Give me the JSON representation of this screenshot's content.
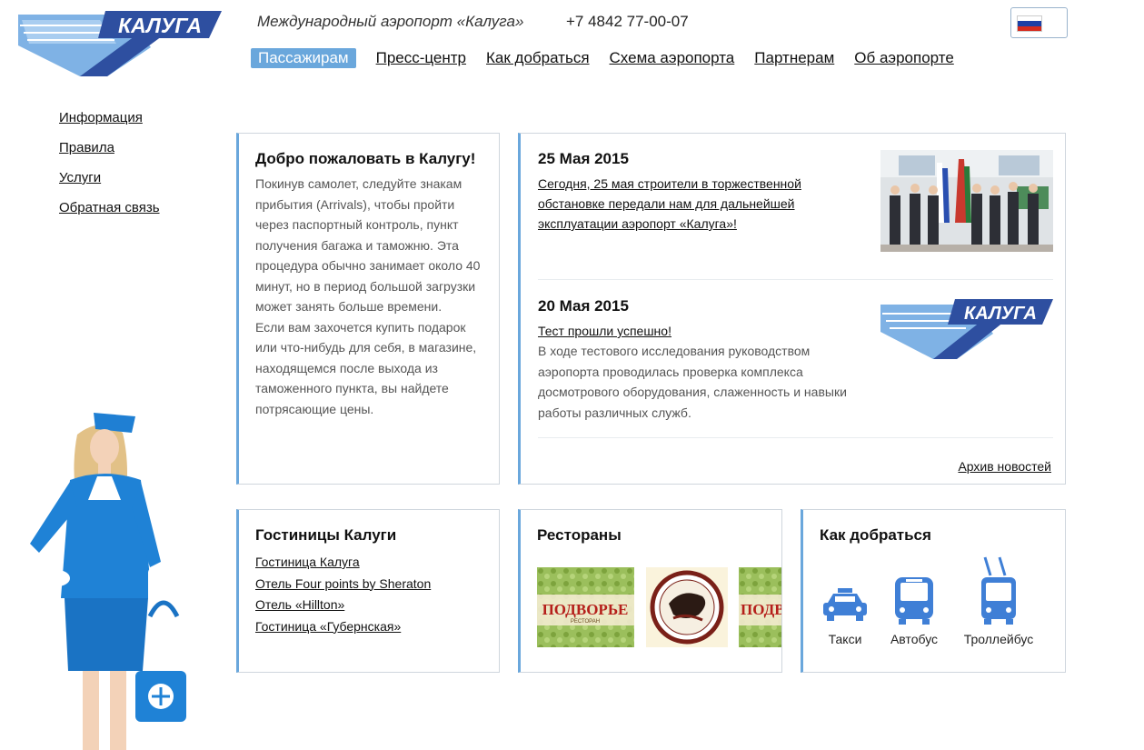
{
  "header": {
    "logo_text": "КАЛУГА",
    "airport_title": "Международный аэропорт «Калуга»",
    "phone": "+7 4842 77-00-07"
  },
  "topnav": [
    {
      "label": "Пассажирам",
      "active": true
    },
    {
      "label": "Пресс-центр",
      "active": false
    },
    {
      "label": "Как добраться",
      "active": false
    },
    {
      "label": "Схема аэропорта",
      "active": false
    },
    {
      "label": "Партнерам",
      "active": false
    },
    {
      "label": "Об аэропорте",
      "active": false
    }
  ],
  "side_menu": [
    "Информация",
    "Правила",
    "Услуги",
    "Обратная связь"
  ],
  "welcome": {
    "title": "Добро пожаловать в Калугу!",
    "text": "Покинув самолет, следуйте знакам прибытия (Arrivals), чтобы пройти через паспортный контроль, пункт получения багажа и таможню. Эта процедура обычно занимает около 40 минут, но в период большой загрузки может занять больше времени.\nЕсли вам захочется купить подарок или что-нибудь для себя, в магазине, находящемся после выхода из таможенного пункта, вы найдете потрясающие цены."
  },
  "news": {
    "items": [
      {
        "date": "25 Мая 2015",
        "link": "Сегодня, 25 мая строители в торжественной обстановке передали нам для дальнейшей эксплуатации аэропорт «Калуга»!",
        "desc": ""
      },
      {
        "date": "20 Мая 2015",
        "link": "Тест прошли успешно!",
        "desc": "В ходе тестового исследования руководством аэропорта проводилась проверка комплекса досмотрового оборудования, слаженность и навыки работы различных служб."
      }
    ],
    "archive": "Архив новостей"
  },
  "hotels": {
    "title": "Гостиницы Калуги",
    "items": [
      "Гостиница Калуга",
      "Отель Four points by Sheraton",
      "Отель «Hillton»",
      "Гостиница «Губернская»"
    ]
  },
  "restaurants": {
    "title": "Рестораны",
    "podvorie": "ПОДВОРЬЕ",
    "podvorie_sub": "РЕСТОРАН",
    "podvorie_crop": "ПОДВ"
  },
  "transport": {
    "title": "Как добраться",
    "items": [
      "Такси",
      "Автобус",
      "Троллейбус"
    ]
  },
  "colors": {
    "accent": "#6aa7dc",
    "logo_dark": "#2e4fa0",
    "logo_light": "#7fb2e5",
    "transport_icon": "#3f7fd6"
  }
}
